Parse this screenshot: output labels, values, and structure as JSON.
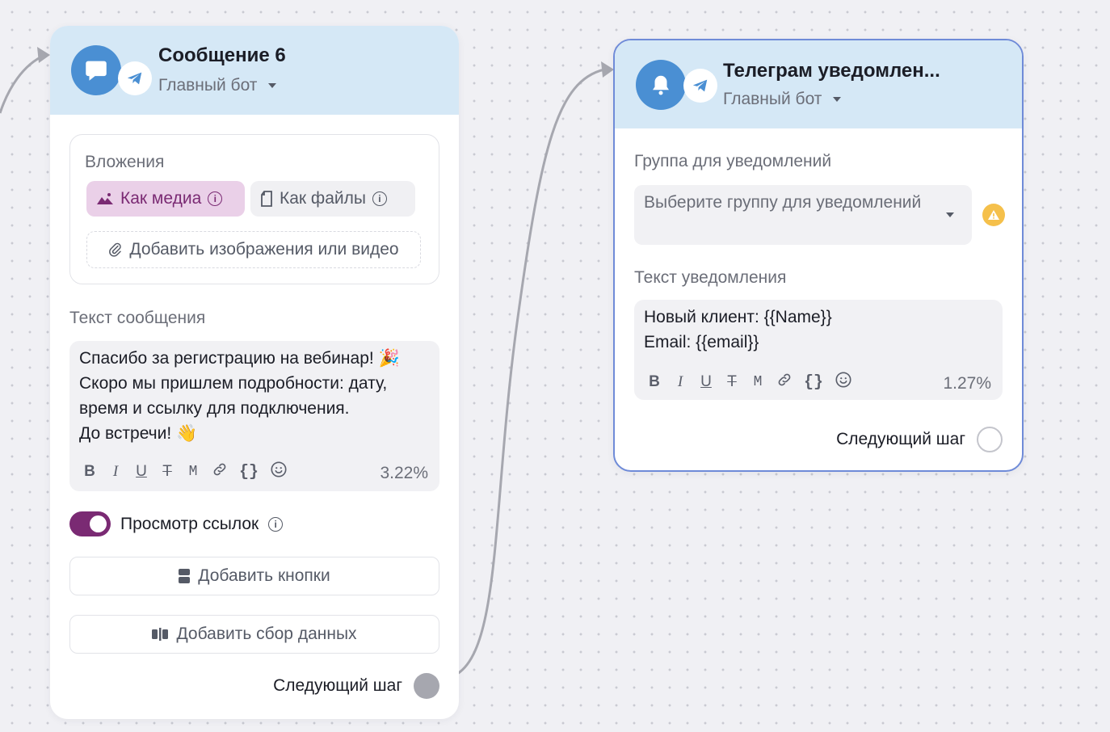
{
  "colors": {
    "canvas_bg": "#f0f0f4",
    "header_bg": "#d5e8f6",
    "accent_blue": "#4a8fd3",
    "accent_purple": "#7a2a73",
    "media_chip_bg": "#ead0e8",
    "selected_border": "#6f8bd8",
    "warning": "#f5c04b"
  },
  "left_node": {
    "icon": "chat-bubble-icon",
    "channel_icon": "telegram-icon",
    "title": "Сообщение 6",
    "bot": "Главный бот",
    "attachments": {
      "label": "Вложения",
      "media_chip": "Как медиа",
      "files_chip": "Как файлы",
      "add_media": "Добавить изображения или видео"
    },
    "message": {
      "label": "Текст сообщения",
      "text": "Спасибо за регистрацию на вебинар! 🎉\nСкоро мы пришлем подробности: дату,\nвремя и ссылку для подключения.\nДо встречи! 👋",
      "percent": "3.22%"
    },
    "toolbar": [
      "B",
      "I",
      "U",
      "T",
      "M",
      "link",
      "{}",
      "emoji"
    ],
    "link_preview": {
      "label": "Просмотр ссылок",
      "enabled": true
    },
    "add_buttons": "Добавить кнопки",
    "add_data_collection": "Добавить сбор данных",
    "next_step": "Следующий шаг"
  },
  "right_node": {
    "icon": "bell-icon",
    "channel_icon": "telegram-icon",
    "title": "Телеграм уведомлен...",
    "bot": "Главный бот",
    "group": {
      "label": "Группа для уведомлений",
      "placeholder": "Выберите группу для уведомлений"
    },
    "notification": {
      "label": "Текст уведомления",
      "text": "Новый клиент: {{Name}}\nEmail: {{email}}",
      "percent": "1.27%"
    },
    "next_step": "Следующий шаг"
  }
}
